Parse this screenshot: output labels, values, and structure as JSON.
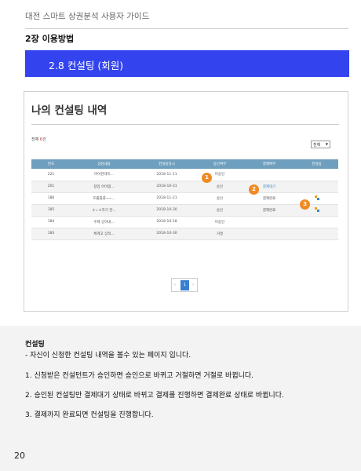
{
  "header": {
    "guide_title": "대전 스마트 상권분석 사용자 가이드"
  },
  "chapter": {
    "title": "2장 이용방법"
  },
  "section": {
    "title": "2.8 컨설팅 (회원)"
  },
  "screenshot": {
    "title": "나의 컨설팅 내역",
    "total_label": "전체 ",
    "total_count": "6",
    "total_unit": "건",
    "filter_value": "전체",
    "table": {
      "headers": [
        "번호",
        "상담내용",
        "컨설팅일시",
        "승인여부",
        "결제여부",
        "컨설팅"
      ],
      "rows": [
        {
          "no": "221",
          "content": "마이컨테이...",
          "date": "2018-11-11",
          "approval": "미승인",
          "payment": "",
          "consulting": ""
        },
        {
          "no": "201",
          "content": "창업 아이템...",
          "date": "2018-10-31",
          "approval": "승인",
          "payment": "결제대기",
          "consulting": ""
        },
        {
          "no": "186",
          "content": "프롤틀릏~~...",
          "date": "2018-11-21",
          "approval": "승인",
          "payment": "결제완료",
          "consulting": "consult-icon"
        },
        {
          "no": "185",
          "content": "ㅎㄴㅎ하기 한...",
          "date": "2018-10-30",
          "approval": "승인",
          "payment": "결제완료",
          "consulting": "consult-icon"
        },
        {
          "no": "184",
          "content": "수제 공아네...",
          "date": "2018-10-18",
          "approval": "미승인",
          "payment": "",
          "consulting": ""
        },
        {
          "no": "183",
          "content": "체계고 상적...",
          "date": "2018-10-30",
          "approval": "거절",
          "payment": "",
          "consulting": ""
        }
      ]
    },
    "pagination": {
      "prev": "‹",
      "current": "1",
      "next": "›"
    },
    "markers": [
      "1",
      "2",
      "3"
    ]
  },
  "description": {
    "title": "컨설팅",
    "subtitle": " - 자신이 신청한 컨설팅 내역을 볼수 있는 페이지 입니다.",
    "steps": [
      "1. 신청받은 컨설턴트가 승인하면 승인으로 바뀌고 거절하면 거절로 바뀝니다.",
      "2. 승인된 컨설팅만 결제대기 상태로 바뀌고 결제를 진행하면 결제완료 상태로 바뀝니다.",
      "3. 결제까지 완료되면 컨설팅을 진행합니다."
    ]
  },
  "page_number": "20",
  "colors": {
    "banner": "#3344ee",
    "marker": "#f08a24",
    "table_header": "#6f9fbe",
    "link": "#3a86c8"
  }
}
